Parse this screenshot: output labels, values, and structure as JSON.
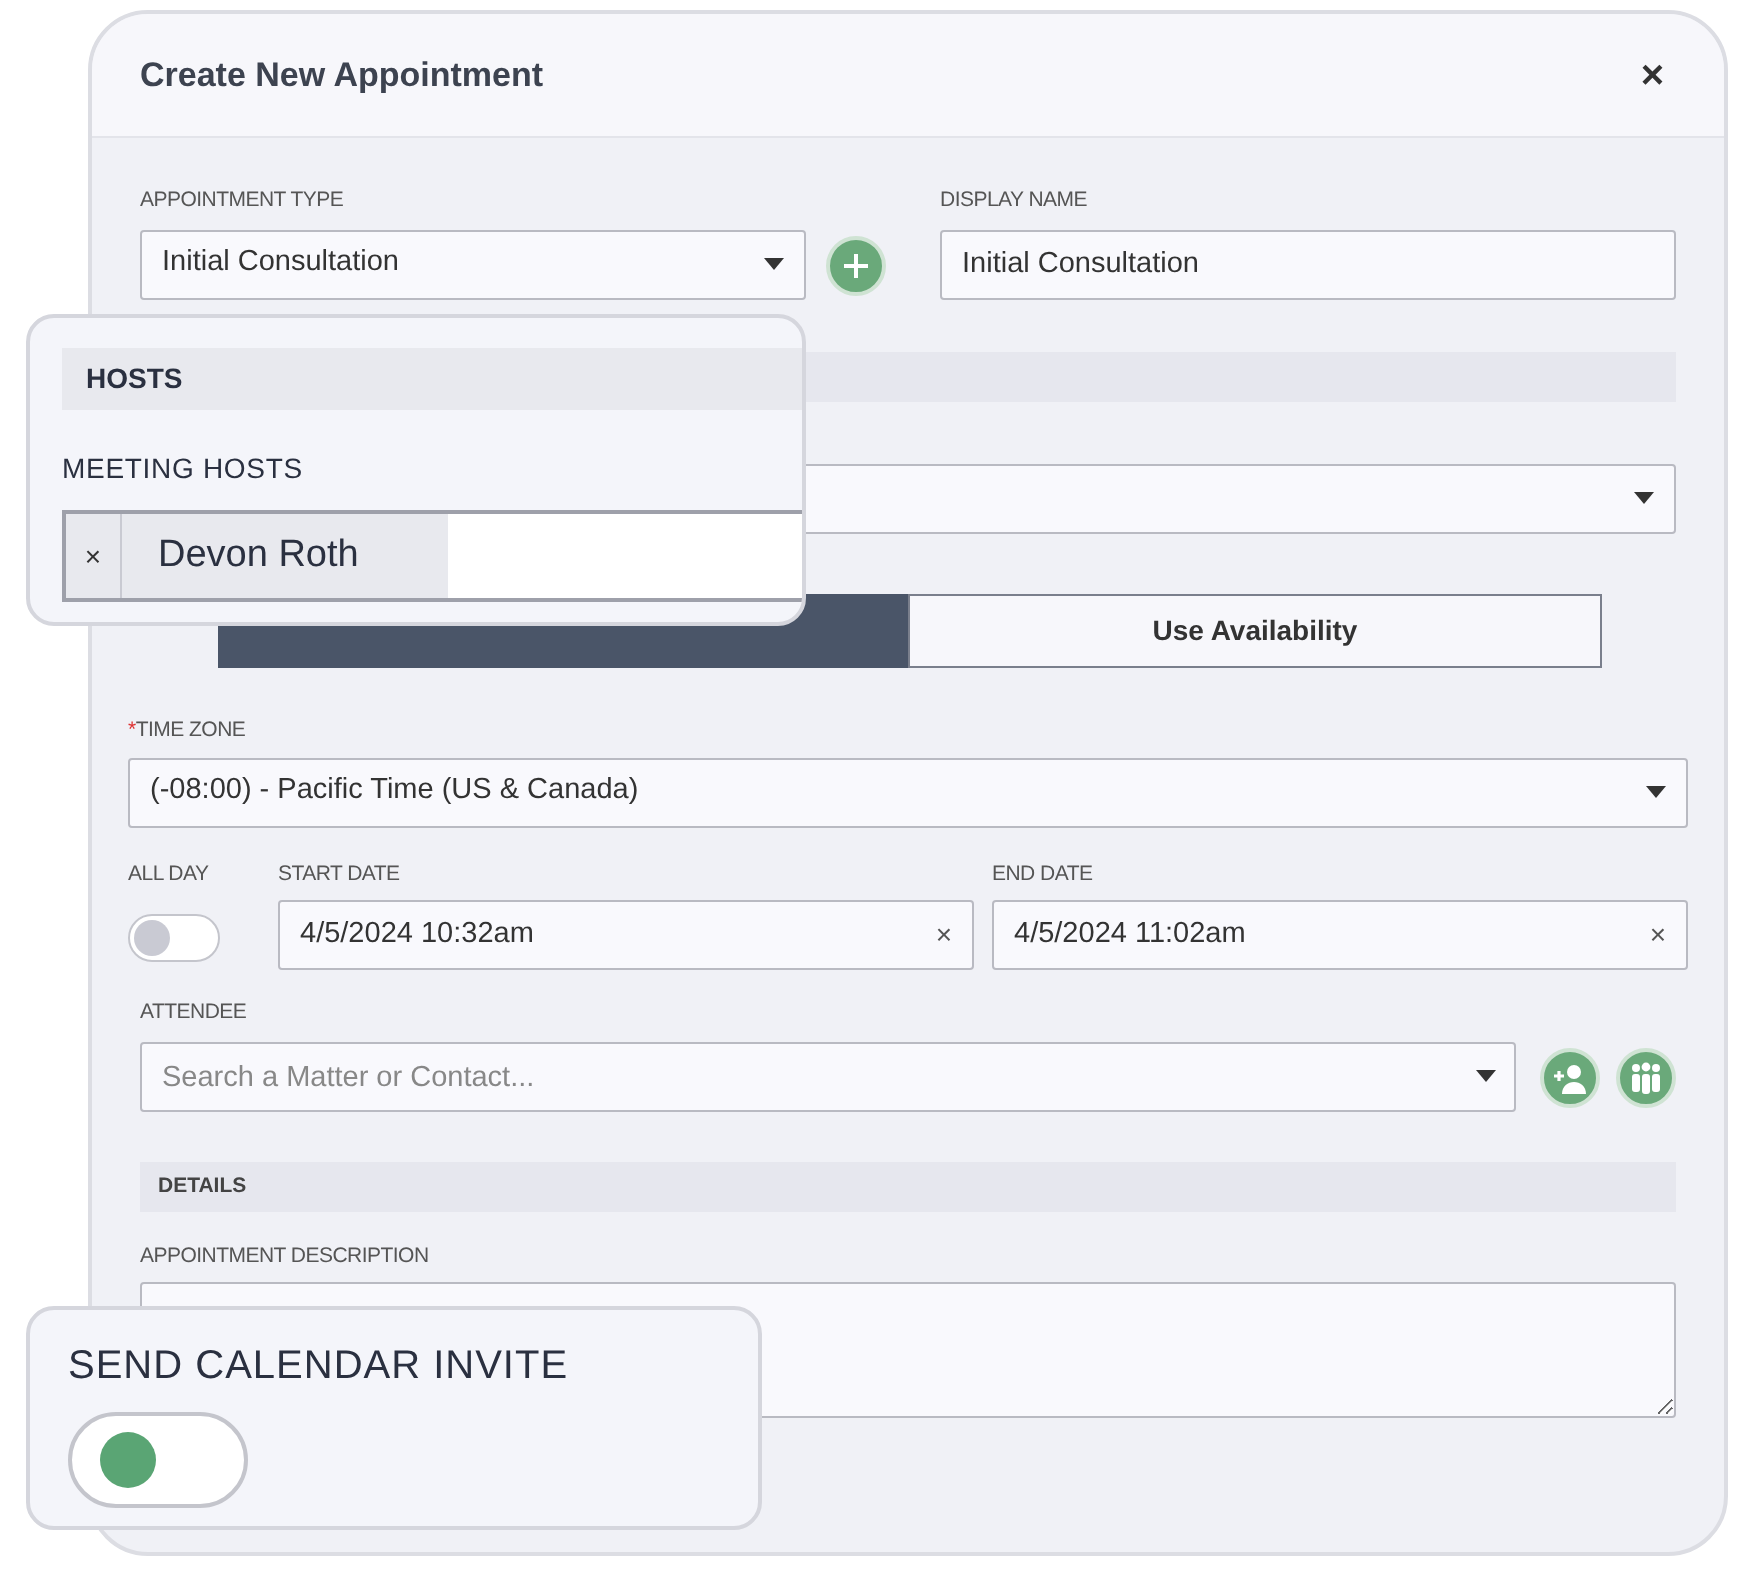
{
  "window": {
    "title": "Create New Appointment",
    "close": "×"
  },
  "appointment_type": {
    "label": "APPOINTMENT TYPE",
    "value": "Initial Consultation"
  },
  "display_name": {
    "label": "DISPLAY NAME",
    "value": "Initial Consultation"
  },
  "booking_mode": [
    {
      "selected": true
    },
    {
      "label": "Use Availability",
      "selected": false
    }
  ],
  "time_zone": {
    "required_mark": "*",
    "label": "TIME ZONE",
    "value": "(-08:00) - Pacific Time (US & Canada)"
  },
  "all_day": {
    "label": "ALL DAY",
    "on": false
  },
  "start_date": {
    "label": "START DATE",
    "value": "4/5/2024 10:32am",
    "clear": "×"
  },
  "end_date": {
    "label": "END DATE",
    "value": "4/5/2024 11:02am",
    "clear": "×"
  },
  "attendee": {
    "label": "ATTENDEE",
    "placeholder": "Search a Matter or Contact..."
  },
  "details_section": {
    "title": "DETAILS"
  },
  "appointment_description": {
    "label": "APPOINTMENT DESCRIPTION"
  },
  "hosts_callout": {
    "title": "HOSTS",
    "label": "MEETING HOSTS",
    "hosts": [
      {
        "remove": "×",
        "name": "Devon Roth"
      }
    ]
  },
  "invite_callout": {
    "label": "SEND CALENDAR INVITE",
    "on": true
  }
}
